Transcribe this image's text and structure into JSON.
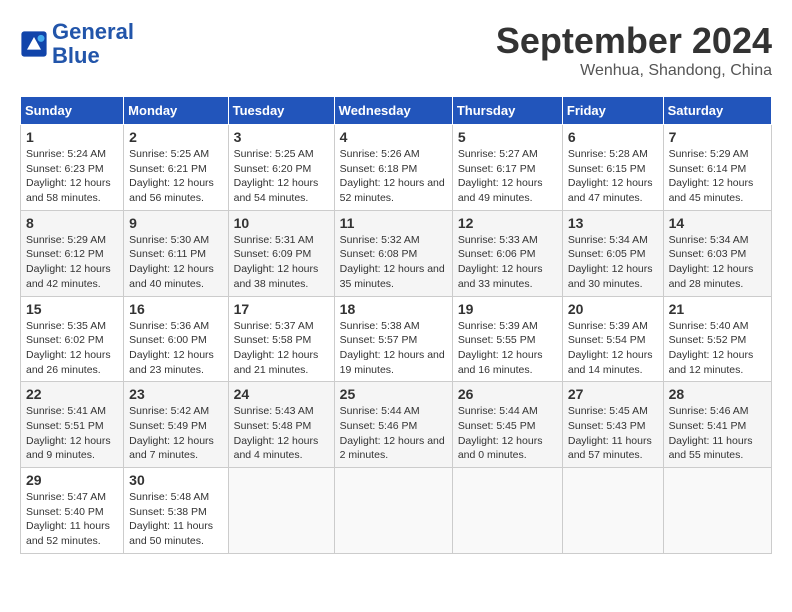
{
  "header": {
    "logo_line1": "General",
    "logo_line2": "Blue",
    "month_year": "September 2024",
    "location": "Wenhua, Shandong, China"
  },
  "days_of_week": [
    "Sunday",
    "Monday",
    "Tuesday",
    "Wednesday",
    "Thursday",
    "Friday",
    "Saturday"
  ],
  "weeks": [
    [
      {
        "day": "1",
        "sunrise": "5:24 AM",
        "sunset": "6:23 PM",
        "daylight": "12 hours and 58 minutes."
      },
      {
        "day": "2",
        "sunrise": "5:25 AM",
        "sunset": "6:21 PM",
        "daylight": "12 hours and 56 minutes."
      },
      {
        "day": "3",
        "sunrise": "5:25 AM",
        "sunset": "6:20 PM",
        "daylight": "12 hours and 54 minutes."
      },
      {
        "day": "4",
        "sunrise": "5:26 AM",
        "sunset": "6:18 PM",
        "daylight": "12 hours and 52 minutes."
      },
      {
        "day": "5",
        "sunrise": "5:27 AM",
        "sunset": "6:17 PM",
        "daylight": "12 hours and 49 minutes."
      },
      {
        "day": "6",
        "sunrise": "5:28 AM",
        "sunset": "6:15 PM",
        "daylight": "12 hours and 47 minutes."
      },
      {
        "day": "7",
        "sunrise": "5:29 AM",
        "sunset": "6:14 PM",
        "daylight": "12 hours and 45 minutes."
      }
    ],
    [
      {
        "day": "8",
        "sunrise": "5:29 AM",
        "sunset": "6:12 PM",
        "daylight": "12 hours and 42 minutes."
      },
      {
        "day": "9",
        "sunrise": "5:30 AM",
        "sunset": "6:11 PM",
        "daylight": "12 hours and 40 minutes."
      },
      {
        "day": "10",
        "sunrise": "5:31 AM",
        "sunset": "6:09 PM",
        "daylight": "12 hours and 38 minutes."
      },
      {
        "day": "11",
        "sunrise": "5:32 AM",
        "sunset": "6:08 PM",
        "daylight": "12 hours and 35 minutes."
      },
      {
        "day": "12",
        "sunrise": "5:33 AM",
        "sunset": "6:06 PM",
        "daylight": "12 hours and 33 minutes."
      },
      {
        "day": "13",
        "sunrise": "5:34 AM",
        "sunset": "6:05 PM",
        "daylight": "12 hours and 30 minutes."
      },
      {
        "day": "14",
        "sunrise": "5:34 AM",
        "sunset": "6:03 PM",
        "daylight": "12 hours and 28 minutes."
      }
    ],
    [
      {
        "day": "15",
        "sunrise": "5:35 AM",
        "sunset": "6:02 PM",
        "daylight": "12 hours and 26 minutes."
      },
      {
        "day": "16",
        "sunrise": "5:36 AM",
        "sunset": "6:00 PM",
        "daylight": "12 hours and 23 minutes."
      },
      {
        "day": "17",
        "sunrise": "5:37 AM",
        "sunset": "5:58 PM",
        "daylight": "12 hours and 21 minutes."
      },
      {
        "day": "18",
        "sunrise": "5:38 AM",
        "sunset": "5:57 PM",
        "daylight": "12 hours and 19 minutes."
      },
      {
        "day": "19",
        "sunrise": "5:39 AM",
        "sunset": "5:55 PM",
        "daylight": "12 hours and 16 minutes."
      },
      {
        "day": "20",
        "sunrise": "5:39 AM",
        "sunset": "5:54 PM",
        "daylight": "12 hours and 14 minutes."
      },
      {
        "day": "21",
        "sunrise": "5:40 AM",
        "sunset": "5:52 PM",
        "daylight": "12 hours and 12 minutes."
      }
    ],
    [
      {
        "day": "22",
        "sunrise": "5:41 AM",
        "sunset": "5:51 PM",
        "daylight": "12 hours and 9 minutes."
      },
      {
        "day": "23",
        "sunrise": "5:42 AM",
        "sunset": "5:49 PM",
        "daylight": "12 hours and 7 minutes."
      },
      {
        "day": "24",
        "sunrise": "5:43 AM",
        "sunset": "5:48 PM",
        "daylight": "12 hours and 4 minutes."
      },
      {
        "day": "25",
        "sunrise": "5:44 AM",
        "sunset": "5:46 PM",
        "daylight": "12 hours and 2 minutes."
      },
      {
        "day": "26",
        "sunrise": "5:44 AM",
        "sunset": "5:45 PM",
        "daylight": "12 hours and 0 minutes."
      },
      {
        "day": "27",
        "sunrise": "5:45 AM",
        "sunset": "5:43 PM",
        "daylight": "11 hours and 57 minutes."
      },
      {
        "day": "28",
        "sunrise": "5:46 AM",
        "sunset": "5:41 PM",
        "daylight": "11 hours and 55 minutes."
      }
    ],
    [
      {
        "day": "29",
        "sunrise": "5:47 AM",
        "sunset": "5:40 PM",
        "daylight": "11 hours and 52 minutes."
      },
      {
        "day": "30",
        "sunrise": "5:48 AM",
        "sunset": "5:38 PM",
        "daylight": "11 hours and 50 minutes."
      },
      null,
      null,
      null,
      null,
      null
    ]
  ]
}
